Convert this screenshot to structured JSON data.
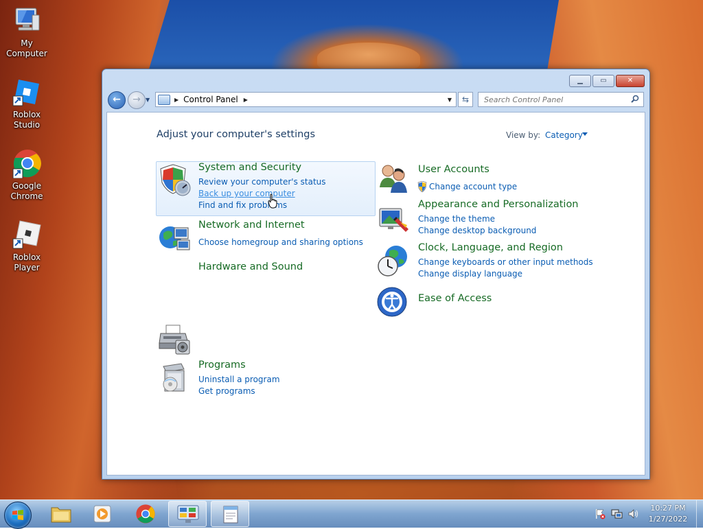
{
  "desktop": {
    "icons": [
      {
        "label": "My Computer",
        "icon": "my-computer-icon"
      },
      {
        "label": "Roblox Studio",
        "icon": "roblox-studio-icon"
      },
      {
        "label": "Google Chrome",
        "icon": "chrome-icon"
      },
      {
        "label": "Roblox Player",
        "icon": "roblox-player-icon"
      }
    ]
  },
  "window": {
    "controls": {
      "minimize": "▁",
      "maximize": "▭",
      "close": "✕"
    },
    "address": {
      "segments": [
        "Control Panel"
      ]
    },
    "search": {
      "placeholder": "Search Control Panel"
    },
    "heading": "Adjust your computer's settings",
    "view_by": {
      "label": "View by:",
      "value": "Category"
    },
    "categories": [
      {
        "title": "System and Security",
        "icon": "shield-icon",
        "links": [
          "Review your computer's status",
          "Back up your computer",
          "Find and fix problems"
        ]
      },
      {
        "title": "Network and Internet",
        "icon": "network-icon",
        "links": [
          "Choose homegroup and sharing options"
        ]
      },
      {
        "title": "Hardware and Sound",
        "icon": "printer-icon",
        "links": []
      },
      {
        "title": "Programs",
        "icon": "programs-icon",
        "links": [
          "Uninstall a program",
          "Get programs"
        ]
      },
      {
        "title": "User Accounts",
        "icon": "users-icon",
        "links": [
          "Change account type"
        ]
      },
      {
        "title": "Appearance and Personalization",
        "icon": "appearance-icon",
        "links": [
          "Change the theme",
          "Change desktop background"
        ]
      },
      {
        "title": "Clock, Language, and Region",
        "icon": "clock-globe-icon",
        "links": [
          "Change keyboards or other input methods",
          "Change display language"
        ]
      },
      {
        "title": "Ease of Access",
        "icon": "ease-of-access-icon",
        "links": []
      }
    ]
  },
  "taskbar": {
    "apps": [
      "start-orb",
      "explorer-icon",
      "media-player-icon",
      "chrome-icon",
      "control-panel-icon",
      "notepad-icon"
    ],
    "clock": {
      "time": "10:27 PM",
      "date": "1/27/2022"
    }
  },
  "colors": {
    "category_title": "#176b25",
    "link": "#0b5db3",
    "heading": "#1e3f66"
  }
}
